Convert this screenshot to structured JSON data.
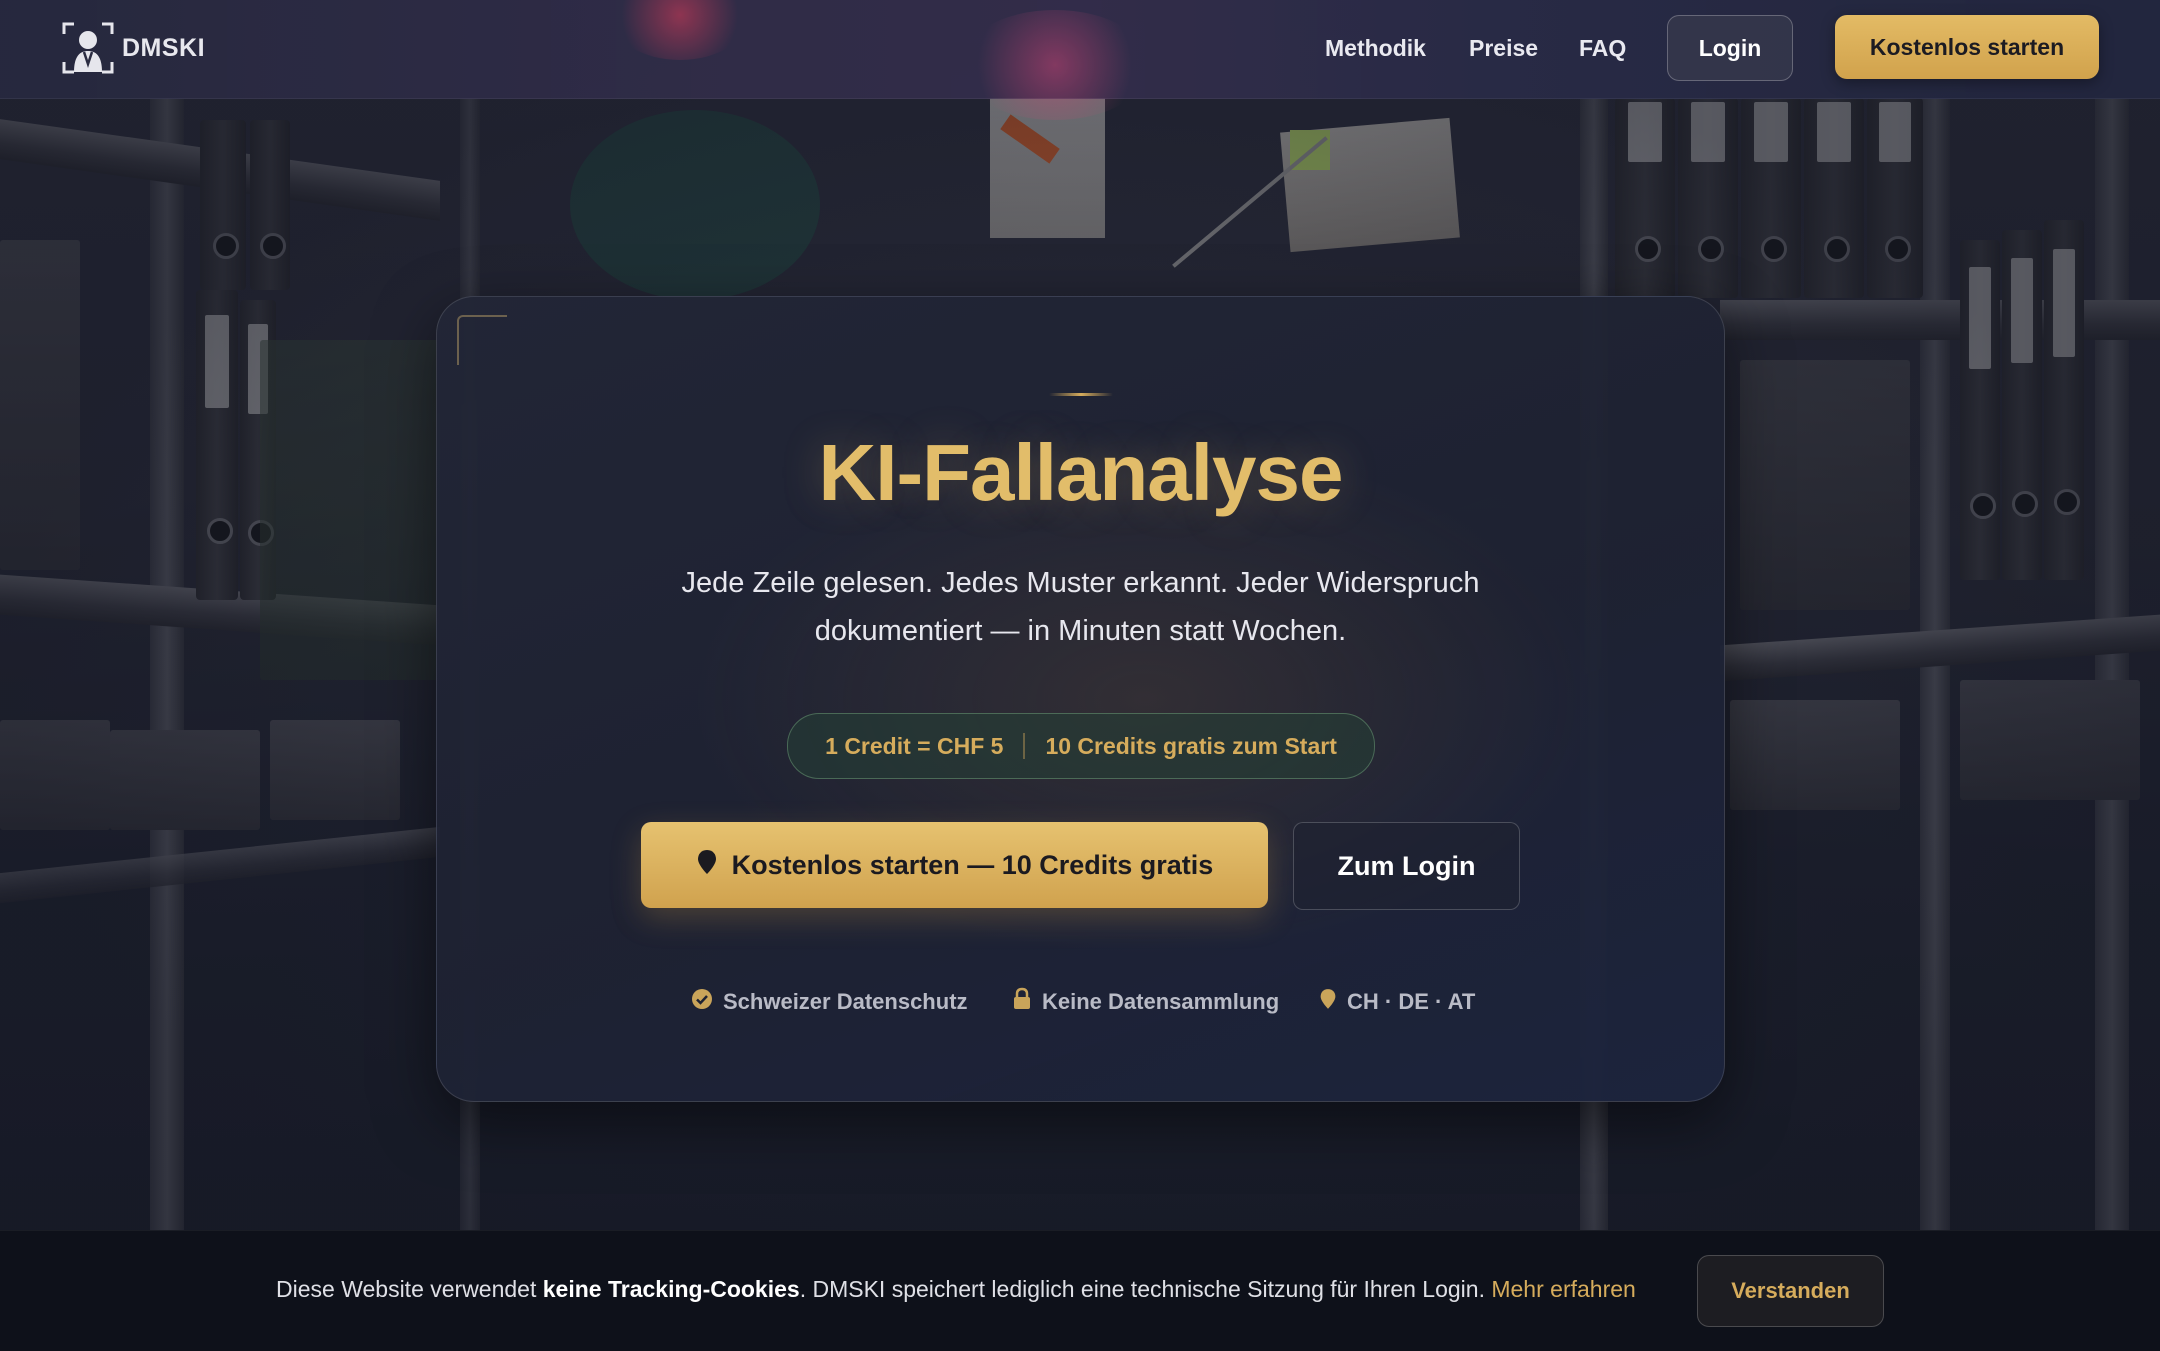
{
  "brand": {
    "name": "DMSKI"
  },
  "nav": {
    "links": [
      "Methodik",
      "Preise",
      "FAQ"
    ],
    "login_label": "Login",
    "start_label": "Kostenlos starten"
  },
  "hero": {
    "title": "KI-Fallanalyse",
    "subtitle_line1": "Jede Zeile gelesen. Jedes Muster erkannt. Jeder Widerspruch",
    "subtitle_line2": "dokumentiert — in Minuten statt Wochen.",
    "pill_left": "1 Credit = CHF 5",
    "pill_right": "10 Credits gratis zum Start",
    "cta_primary": "Kostenlos starten — 10 Credits gratis",
    "cta_secondary": "Zum Login",
    "trust": [
      {
        "icon": "check-circle-icon",
        "label": "Schweizer Datenschutz"
      },
      {
        "icon": "lock-icon",
        "label": "Keine Datensammlung"
      },
      {
        "icon": "location-pin-icon",
        "label": "CH · DE · AT"
      }
    ]
  },
  "cookie": {
    "text_before": "Diese Website verwendet ",
    "text_bold": "keine Tracking-Cookies",
    "text_after": ". DMSKI speichert lediglich eine technische Sitzung für Ihren Login. ",
    "link": "Mehr erfahren",
    "button": "Verstanden"
  },
  "colors": {
    "accent_gold": "#d6ac5c",
    "nav_bg": "#2e2e48",
    "card_bg": "#222636",
    "cookie_bg": "#0e111a"
  }
}
